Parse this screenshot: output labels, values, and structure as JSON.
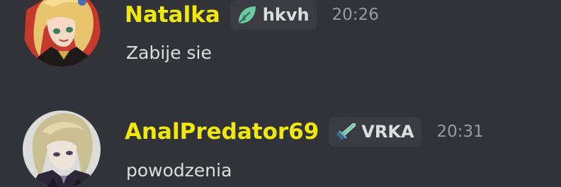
{
  "messages": [
    {
      "username": "Natalka",
      "username_color": "#f1e80a",
      "avatar": "anime-avatar-blonde",
      "tag": {
        "icon": "leaf-icon",
        "text": "hkvh"
      },
      "timestamp": "20:26",
      "content": "Zabije sie"
    },
    {
      "username": "AnalPredator69",
      "username_color": "#f1e80a",
      "avatar": "anime-avatar-pale",
      "tag": {
        "icon": "sword-icon",
        "text": "VRKA"
      },
      "timestamp": "20:31",
      "content": "powodzenia"
    }
  ],
  "colors": {
    "background": "#313338",
    "tag_background": "#3a3c42",
    "text": "#dbdee1",
    "timestamp": "#949ba4",
    "accent_green": "#6ec9a3"
  }
}
